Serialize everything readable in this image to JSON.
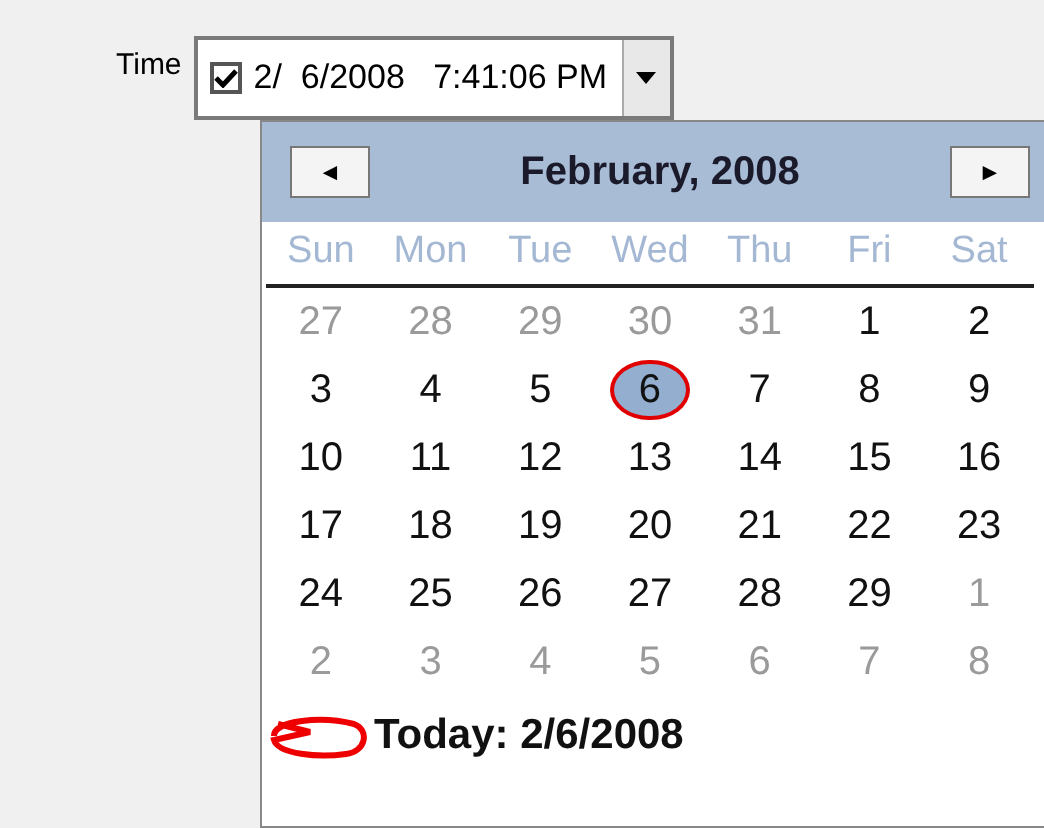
{
  "field": {
    "label": "Time",
    "checked": true,
    "value": "2/  6/2008   7:41:06 PM"
  },
  "calendar": {
    "prev": "◄",
    "title": "February, 2008",
    "next": "►",
    "weekdays": [
      "Sun",
      "Mon",
      "Tue",
      "Wed",
      "Thu",
      "Fri",
      "Sat"
    ],
    "days": [
      {
        "label": "27",
        "kind": "other",
        "selected": false
      },
      {
        "label": "28",
        "kind": "other",
        "selected": false
      },
      {
        "label": "29",
        "kind": "other",
        "selected": false
      },
      {
        "label": "30",
        "kind": "other",
        "selected": false
      },
      {
        "label": "31",
        "kind": "other",
        "selected": false
      },
      {
        "label": "1",
        "kind": "current",
        "selected": false
      },
      {
        "label": "2",
        "kind": "current",
        "selected": false
      },
      {
        "label": "3",
        "kind": "current",
        "selected": false
      },
      {
        "label": "4",
        "kind": "current",
        "selected": false
      },
      {
        "label": "5",
        "kind": "current",
        "selected": false
      },
      {
        "label": "6",
        "kind": "current",
        "selected": true
      },
      {
        "label": "7",
        "kind": "current",
        "selected": false
      },
      {
        "label": "8",
        "kind": "current",
        "selected": false
      },
      {
        "label": "9",
        "kind": "current",
        "selected": false
      },
      {
        "label": "10",
        "kind": "current",
        "selected": false
      },
      {
        "label": "11",
        "kind": "current",
        "selected": false
      },
      {
        "label": "12",
        "kind": "current",
        "selected": false
      },
      {
        "label": "13",
        "kind": "current",
        "selected": false
      },
      {
        "label": "14",
        "kind": "current",
        "selected": false
      },
      {
        "label": "15",
        "kind": "current",
        "selected": false
      },
      {
        "label": "16",
        "kind": "current",
        "selected": false
      },
      {
        "label": "17",
        "kind": "current",
        "selected": false
      },
      {
        "label": "18",
        "kind": "current",
        "selected": false
      },
      {
        "label": "19",
        "kind": "current",
        "selected": false
      },
      {
        "label": "20",
        "kind": "current",
        "selected": false
      },
      {
        "label": "21",
        "kind": "current",
        "selected": false
      },
      {
        "label": "22",
        "kind": "current",
        "selected": false
      },
      {
        "label": "23",
        "kind": "current",
        "selected": false
      },
      {
        "label": "24",
        "kind": "current",
        "selected": false
      },
      {
        "label": "25",
        "kind": "current",
        "selected": false
      },
      {
        "label": "26",
        "kind": "current",
        "selected": false
      },
      {
        "label": "27",
        "kind": "current",
        "selected": false
      },
      {
        "label": "28",
        "kind": "current",
        "selected": false
      },
      {
        "label": "29",
        "kind": "current",
        "selected": false
      },
      {
        "label": "1",
        "kind": "other",
        "selected": false
      },
      {
        "label": "2",
        "kind": "other",
        "selected": false
      },
      {
        "label": "3",
        "kind": "other",
        "selected": false
      },
      {
        "label": "4",
        "kind": "other",
        "selected": false
      },
      {
        "label": "5",
        "kind": "other",
        "selected": false
      },
      {
        "label": "6",
        "kind": "other",
        "selected": false
      },
      {
        "label": "7",
        "kind": "other",
        "selected": false
      },
      {
        "label": "8",
        "kind": "other",
        "selected": false
      }
    ],
    "today": "Today: 2/6/2008"
  }
}
